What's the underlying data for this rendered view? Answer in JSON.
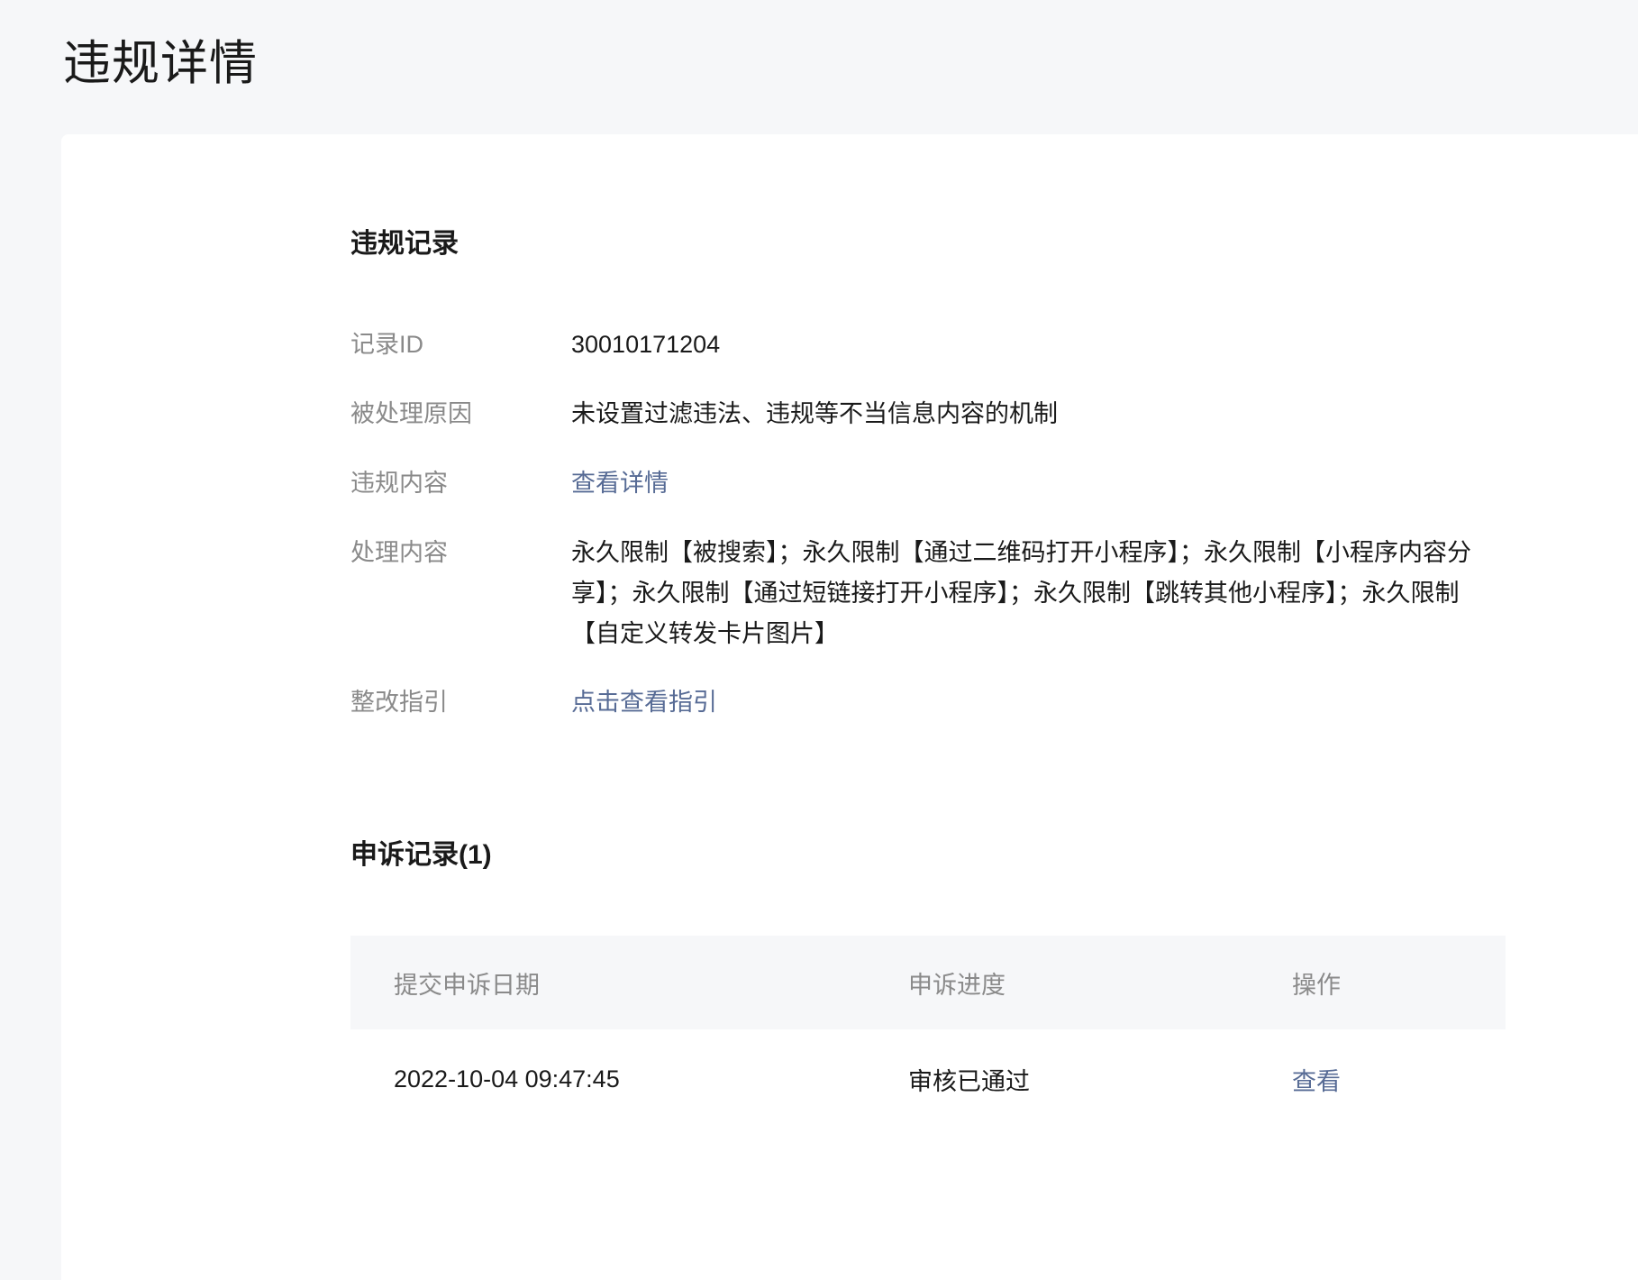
{
  "page": {
    "title": "违规详情"
  },
  "violation": {
    "section_title": "违规记录",
    "rows": {
      "record_id": {
        "label": "记录ID",
        "value": "30010171204"
      },
      "reason": {
        "label": "被处理原因",
        "value": "未设置过滤违法、违规等不当信息内容的机制"
      },
      "content": {
        "label": "违规内容",
        "link": "查看详情"
      },
      "handling": {
        "label": "处理内容",
        "value": "永久限制【被搜索】；永久限制【通过二维码打开小程序】；永久限制【小程序内容分享】；永久限制【通过短链接打开小程序】；永久限制【跳转其他小程序】；永久限制【自定义转发卡片图片】"
      },
      "guide": {
        "label": "整改指引",
        "link": "点击查看指引"
      }
    }
  },
  "appeal": {
    "section_title": "申诉记录(1)",
    "table": {
      "headers": [
        "提交申诉日期",
        "申诉进度",
        "操作"
      ],
      "rows": [
        {
          "date": "2022-10-04 09:47:45",
          "progress": "审核已通过",
          "action": "查看"
        }
      ]
    }
  },
  "colors": {
    "link": "#576b95",
    "label": "#8a8a8a",
    "text": "#1a1a1a",
    "page_bg": "#f6f7f9",
    "card_bg": "#ffffff"
  }
}
